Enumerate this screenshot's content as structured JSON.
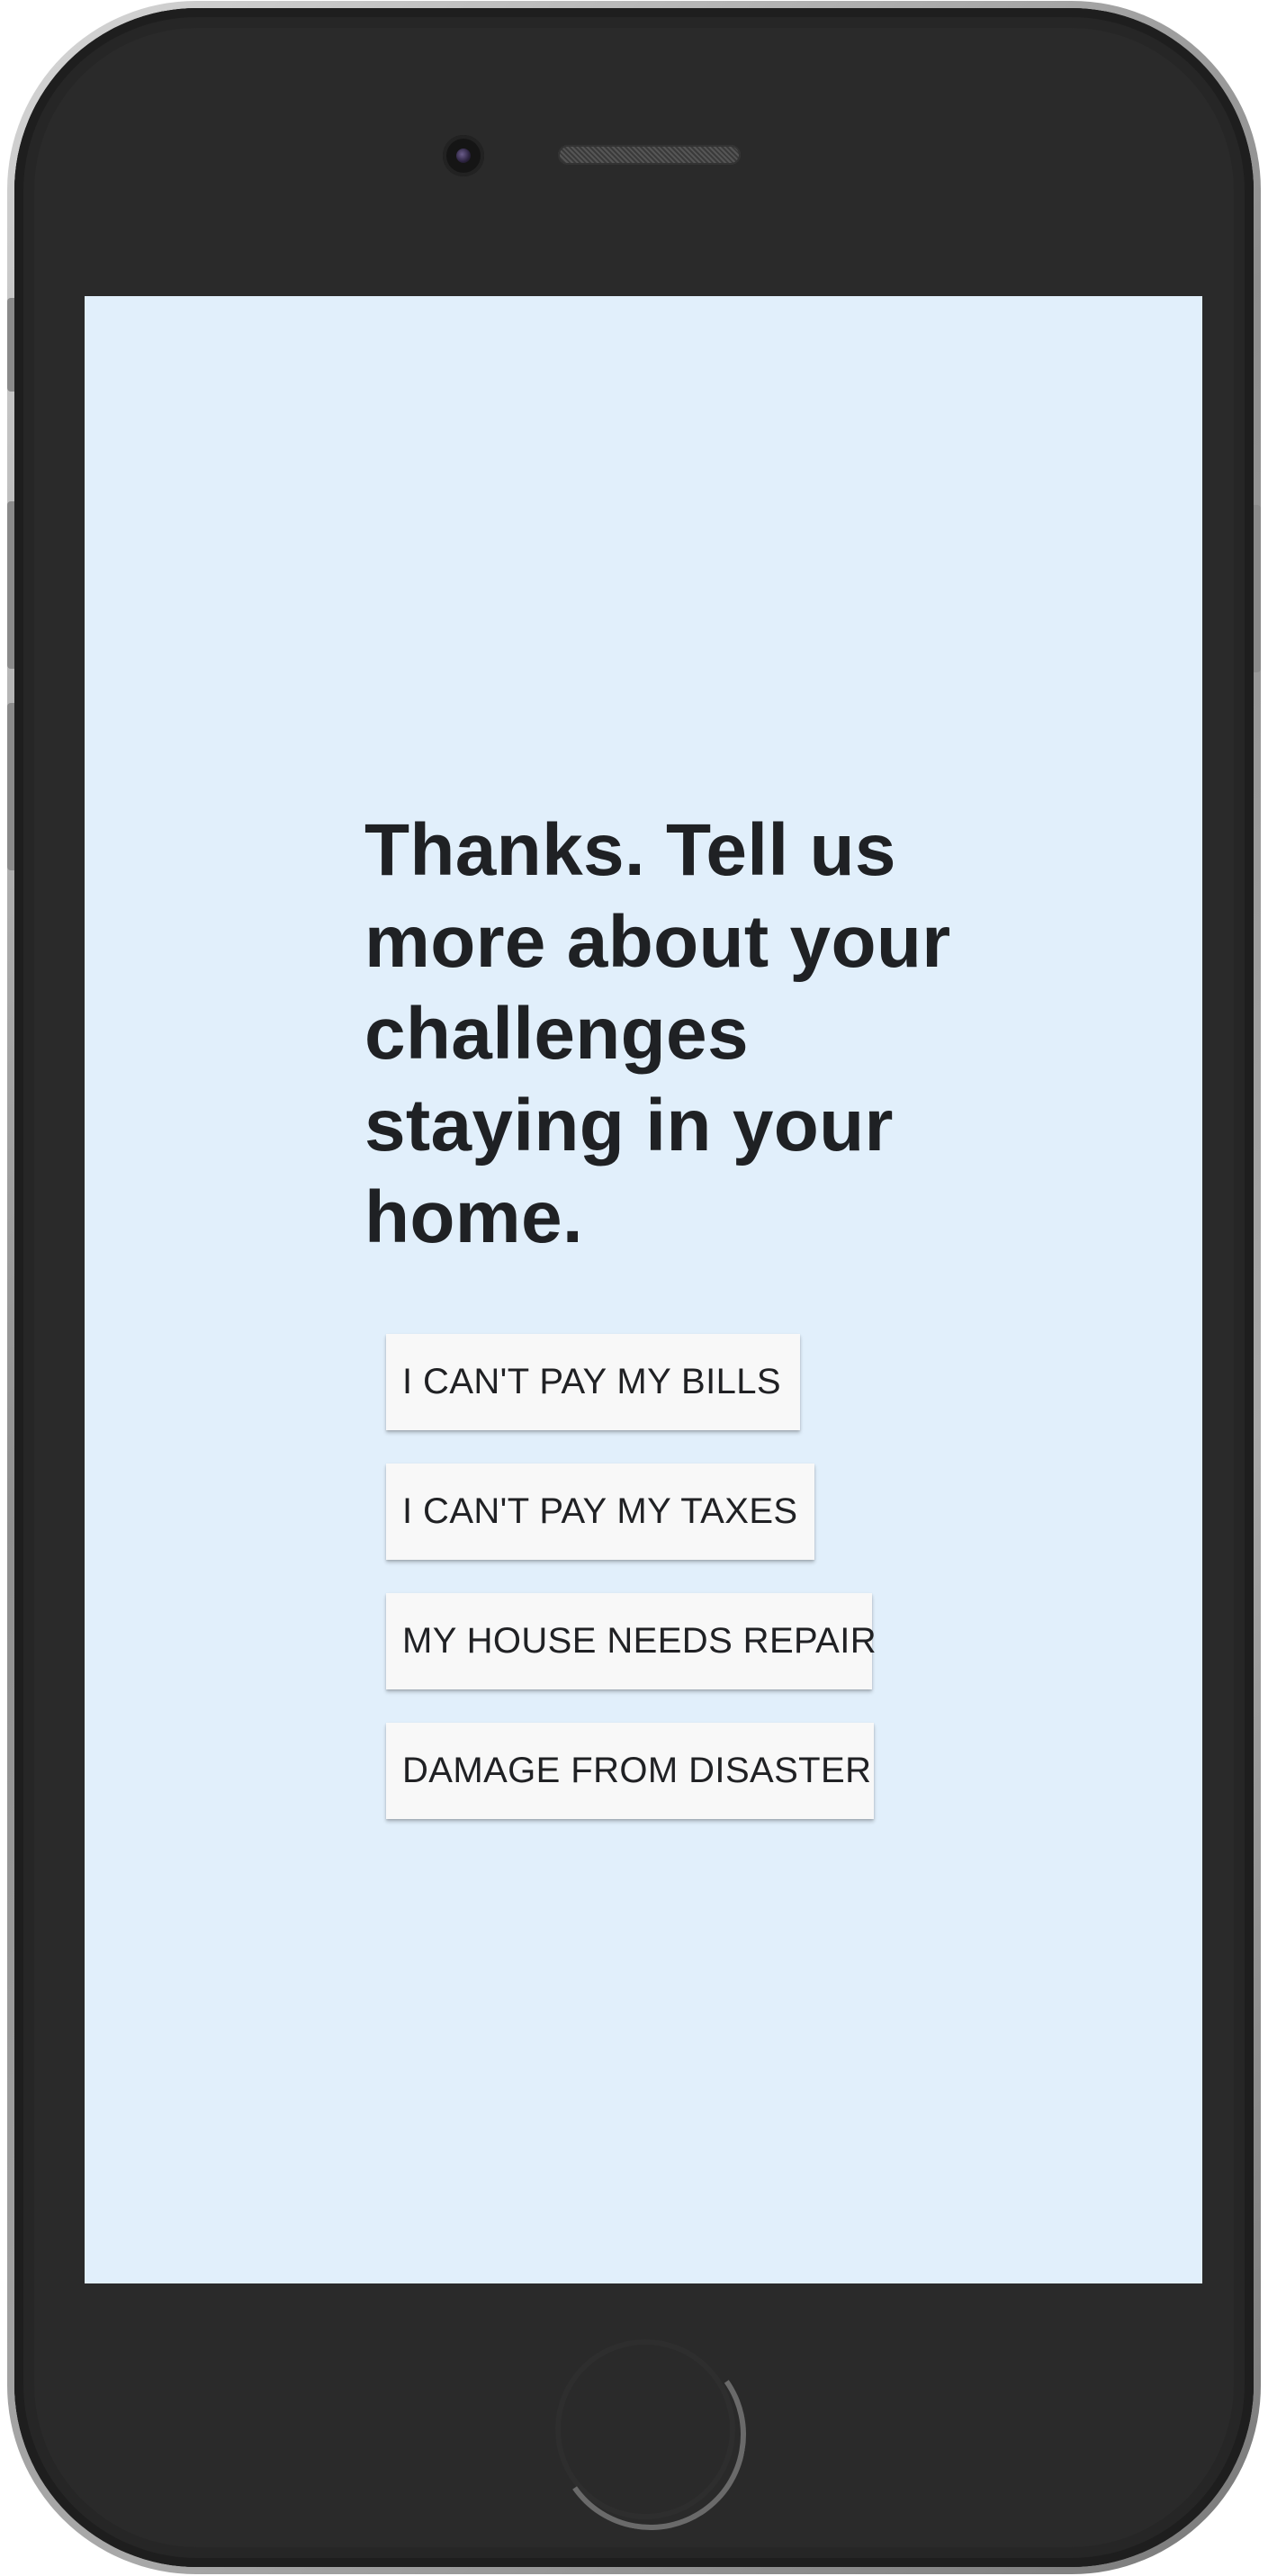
{
  "screen": {
    "heading": "Thanks. Tell us more about your challenges staying in your home.",
    "options": [
      {
        "label": "I CAN'T PAY MY BILLS"
      },
      {
        "label": "I CAN'T PAY MY TAXES"
      },
      {
        "label": "MY HOUSE NEEDS REPAIR"
      },
      {
        "label": "DAMAGE FROM DISASTER"
      }
    ]
  },
  "colors": {
    "screen_background": "#e1effb",
    "button_background": "#f8f8f8",
    "text": "#1f2124",
    "device_body": "#2a2a2a"
  },
  "icons": {
    "front_camera": "camera-icon",
    "earpiece": "speaker-icon",
    "home_button": "home-button-icon"
  }
}
